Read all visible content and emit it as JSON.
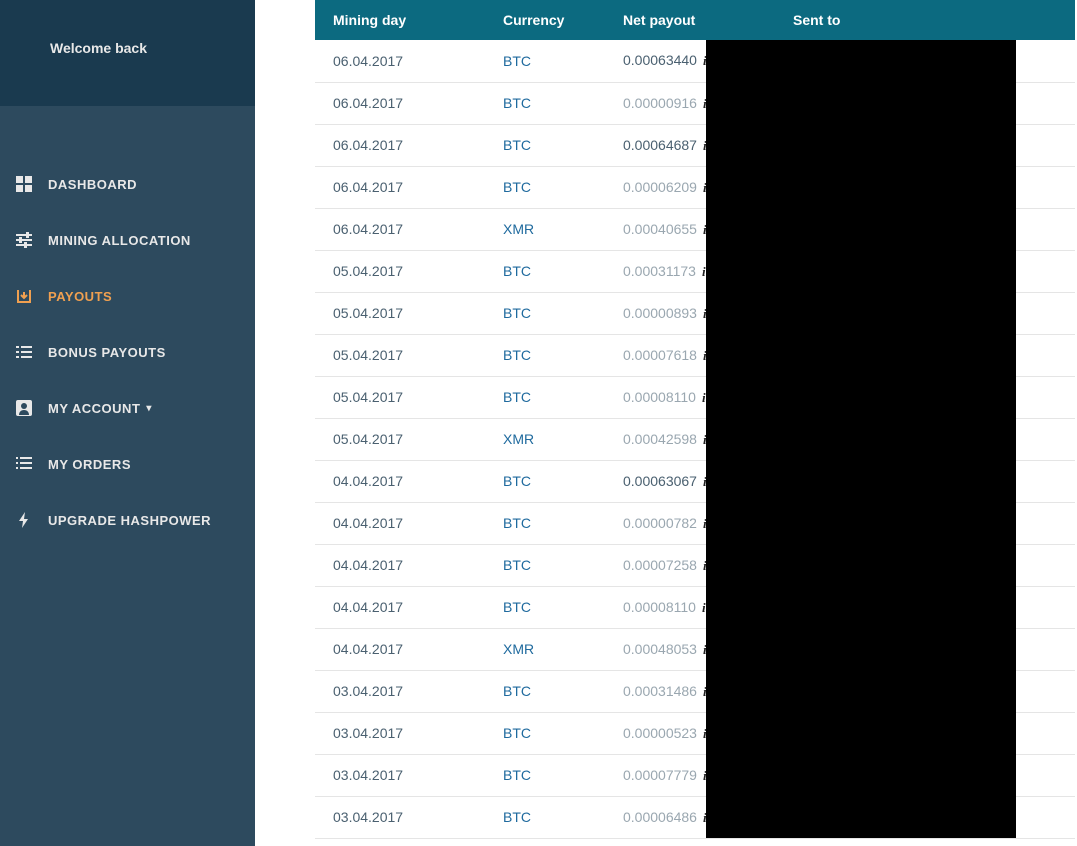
{
  "sidebar": {
    "welcome": "Welcome back",
    "items": [
      {
        "label": "DASHBOARD"
      },
      {
        "label": "MINING ALLOCATION"
      },
      {
        "label": "PAYOUTS"
      },
      {
        "label": "BONUS PAYOUTS"
      },
      {
        "label": "MY ACCOUNT"
      },
      {
        "label": "MY ORDERS"
      },
      {
        "label": "UPGRADE HASHPOWER"
      }
    ]
  },
  "table": {
    "headers": {
      "mining_day": "Mining day",
      "currency": "Currency",
      "net_payout": "Net payout",
      "sent_to": "Sent to"
    },
    "rows": [
      {
        "date": "06.04.2017",
        "currency": "BTC",
        "payout": "0.00063440",
        "dim": false
      },
      {
        "date": "06.04.2017",
        "currency": "BTC",
        "payout": "0.00000916",
        "dim": true
      },
      {
        "date": "06.04.2017",
        "currency": "BTC",
        "payout": "0.00064687",
        "dim": false
      },
      {
        "date": "06.04.2017",
        "currency": "BTC",
        "payout": "0.00006209",
        "dim": true
      },
      {
        "date": "06.04.2017",
        "currency": "XMR",
        "payout": "0.00040655",
        "dim": true
      },
      {
        "date": "05.04.2017",
        "currency": "BTC",
        "payout": "0.00031173",
        "dim": true
      },
      {
        "date": "05.04.2017",
        "currency": "BTC",
        "payout": "0.00000893",
        "dim": true
      },
      {
        "date": "05.04.2017",
        "currency": "BTC",
        "payout": "0.00007618",
        "dim": true
      },
      {
        "date": "05.04.2017",
        "currency": "BTC",
        "payout": "0.00008110",
        "dim": true
      },
      {
        "date": "05.04.2017",
        "currency": "XMR",
        "payout": "0.00042598",
        "dim": true
      },
      {
        "date": "04.04.2017",
        "currency": "BTC",
        "payout": "0.00063067",
        "dim": false
      },
      {
        "date": "04.04.2017",
        "currency": "BTC",
        "payout": "0.00000782",
        "dim": true
      },
      {
        "date": "04.04.2017",
        "currency": "BTC",
        "payout": "0.00007258",
        "dim": true
      },
      {
        "date": "04.04.2017",
        "currency": "BTC",
        "payout": "0.00008110",
        "dim": true
      },
      {
        "date": "04.04.2017",
        "currency": "XMR",
        "payout": "0.00048053",
        "dim": true
      },
      {
        "date": "03.04.2017",
        "currency": "BTC",
        "payout": "0.00031486",
        "dim": true
      },
      {
        "date": "03.04.2017",
        "currency": "BTC",
        "payout": "0.00000523",
        "dim": true
      },
      {
        "date": "03.04.2017",
        "currency": "BTC",
        "payout": "0.00007779",
        "dim": true
      },
      {
        "date": "03.04.2017",
        "currency": "BTC",
        "payout": "0.00006486",
        "dim": true
      }
    ]
  }
}
